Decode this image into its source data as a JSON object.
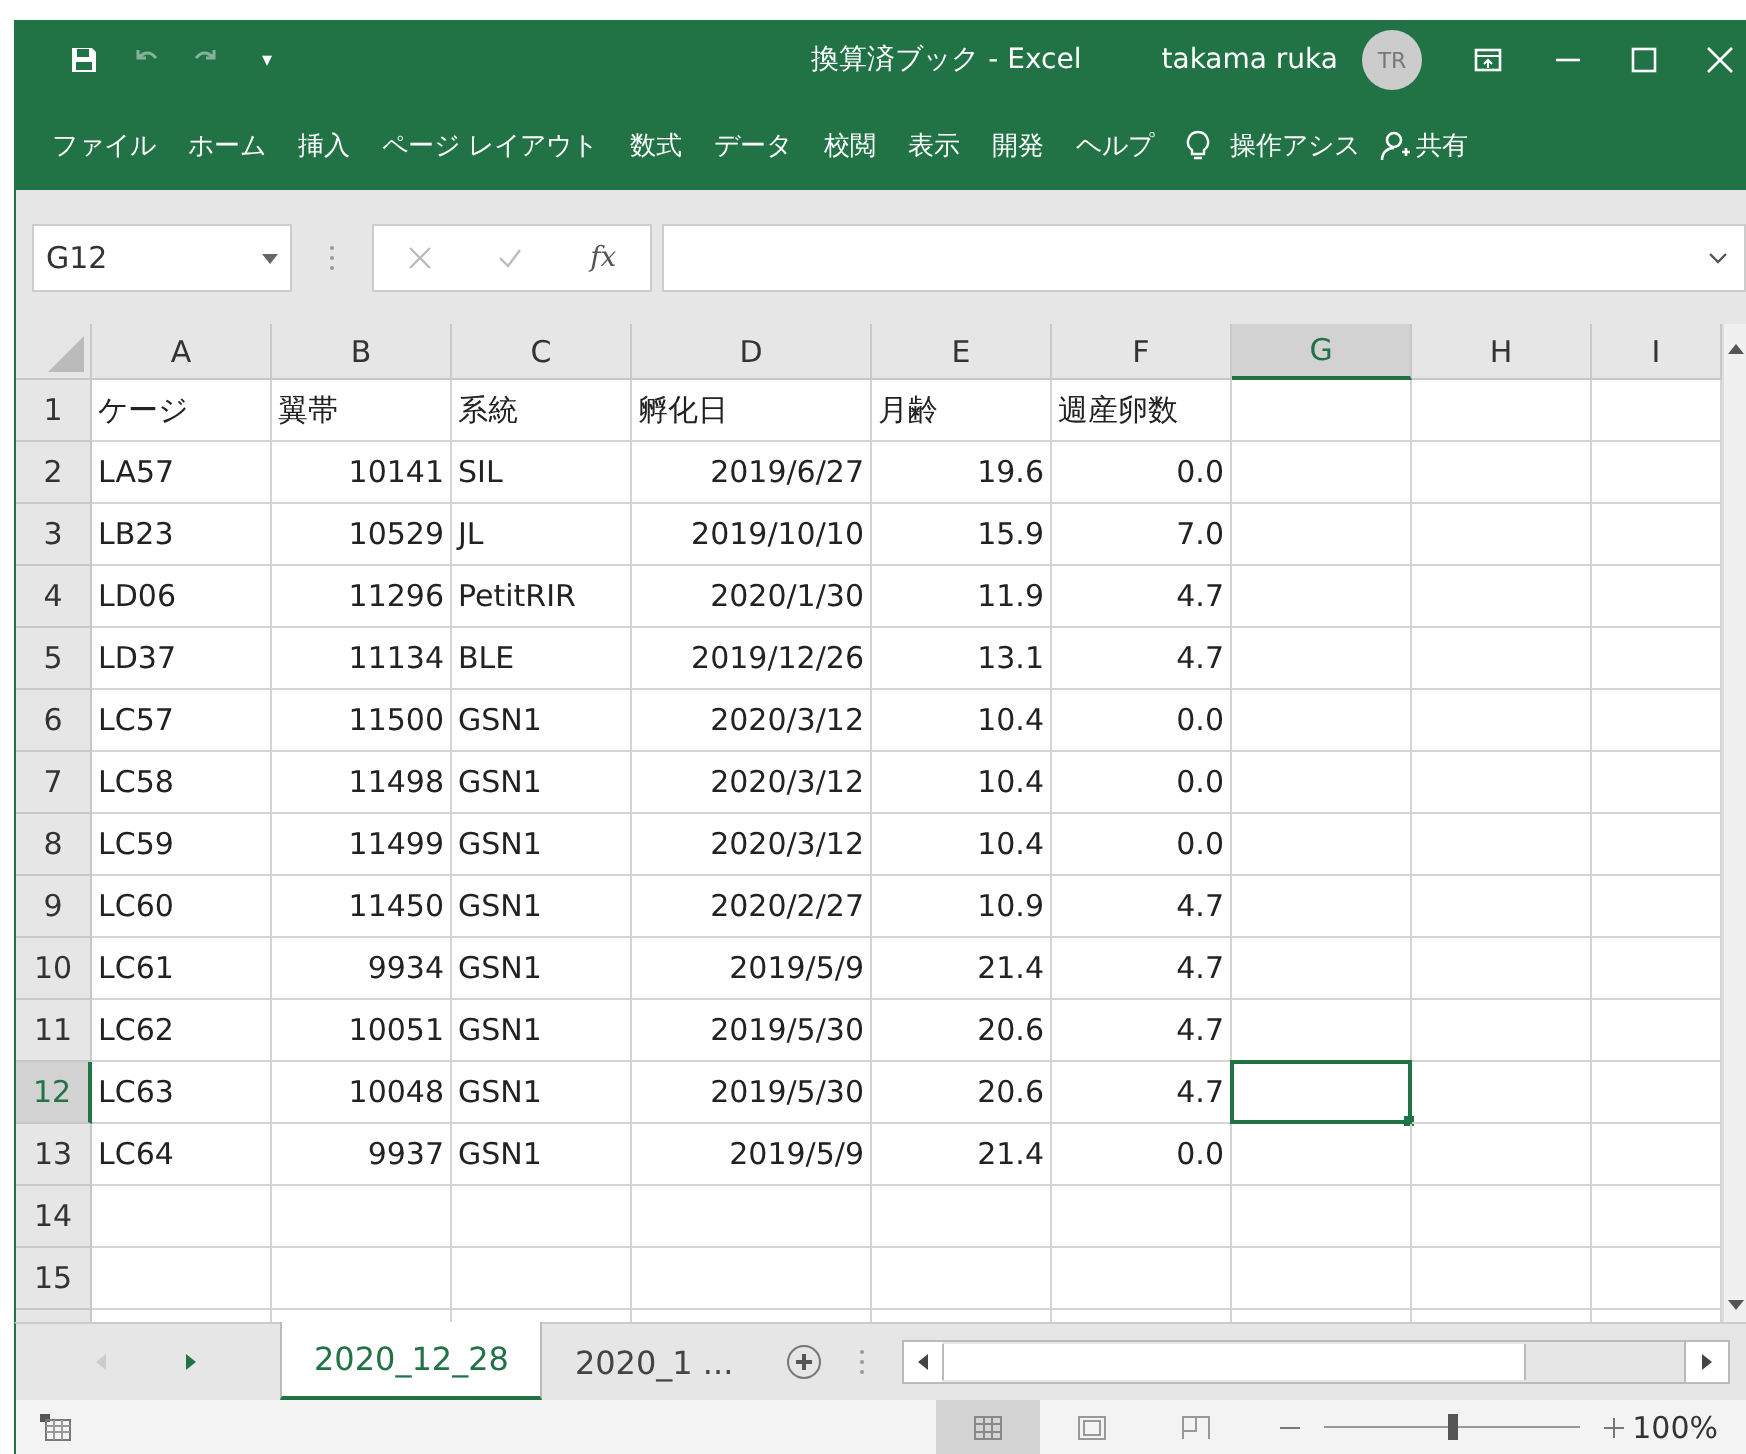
{
  "window": {
    "title": "換算済ブック  -  Excel",
    "user": "takama ruka",
    "avatar": "TR"
  },
  "qat": {
    "dropdown": "▾"
  },
  "ribbon_tabs": [
    {
      "label": "ファイル"
    },
    {
      "label": "ホーム"
    },
    {
      "label": "挿入"
    },
    {
      "label": "ページ レイアウト"
    },
    {
      "label": "数式"
    },
    {
      "label": "データ"
    },
    {
      "label": "校閲"
    },
    {
      "label": "表示"
    },
    {
      "label": "開発"
    },
    {
      "label": "ヘルプ"
    }
  ],
  "tell_me": "操作アシス",
  "share": "共有",
  "formula_bar": {
    "name_box": "G12",
    "fx": "fx"
  },
  "columns": [
    {
      "label": "A",
      "kind": "text",
      "selected": false
    },
    {
      "label": "B",
      "kind": "number",
      "selected": false
    },
    {
      "label": "C",
      "kind": "text",
      "selected": false
    },
    {
      "label": "D",
      "kind": "number",
      "selected": false
    },
    {
      "label": "E",
      "kind": "number",
      "selected": false
    },
    {
      "label": "F",
      "kind": "number",
      "selected": false
    },
    {
      "label": "G",
      "kind": "text",
      "selected": true
    },
    {
      "label": "H",
      "kind": "text",
      "selected": false
    },
    {
      "label": "I",
      "kind": "text",
      "selected": false
    }
  ],
  "rows": [
    {
      "header": "1",
      "selected": false,
      "kind": "header",
      "cells": [
        "ケージ",
        "翼帯",
        "系統",
        "孵化日",
        "月齢",
        "週産卵数"
      ]
    },
    {
      "header": "2",
      "selected": false,
      "kind": "data",
      "cells": [
        "LA57",
        "10141",
        "SIL",
        "2019/6/27",
        "19.6",
        "0.0"
      ]
    },
    {
      "header": "3",
      "selected": false,
      "kind": "data",
      "cells": [
        "LB23",
        "10529",
        "JL",
        "2019/10/10",
        "15.9",
        "7.0"
      ]
    },
    {
      "header": "4",
      "selected": false,
      "kind": "data",
      "cells": [
        "LD06",
        "11296",
        "PetitRIR",
        "2020/1/30",
        "11.9",
        "4.7"
      ]
    },
    {
      "header": "5",
      "selected": false,
      "kind": "data",
      "cells": [
        "LD37",
        "11134",
        "BLE",
        "2019/12/26",
        "13.1",
        "4.7"
      ]
    },
    {
      "header": "6",
      "selected": false,
      "kind": "data",
      "cells": [
        "LC57",
        "11500",
        "GSN1",
        "2020/3/12",
        "10.4",
        "0.0"
      ]
    },
    {
      "header": "7",
      "selected": false,
      "kind": "data",
      "cells": [
        "LC58",
        "11498",
        "GSN1",
        "2020/3/12",
        "10.4",
        "0.0"
      ]
    },
    {
      "header": "8",
      "selected": false,
      "kind": "data",
      "cells": [
        "LC59",
        "11499",
        "GSN1",
        "2020/3/12",
        "10.4",
        "0.0"
      ]
    },
    {
      "header": "9",
      "selected": false,
      "kind": "data",
      "cells": [
        "LC60",
        "11450",
        "GSN1",
        "2020/2/27",
        "10.9",
        "4.7"
      ]
    },
    {
      "header": "10",
      "selected": false,
      "kind": "data",
      "cells": [
        "LC61",
        "9934",
        "GSN1",
        "2019/5/9",
        "21.4",
        "4.7"
      ]
    },
    {
      "header": "11",
      "selected": false,
      "kind": "data",
      "cells": [
        "LC62",
        "10051",
        "GSN1",
        "2019/5/30",
        "20.6",
        "4.7"
      ]
    },
    {
      "header": "12",
      "selected": true,
      "kind": "data",
      "cells": [
        "LC63",
        "10048",
        "GSN1",
        "2019/5/30",
        "20.6",
        "4.7"
      ]
    },
    {
      "header": "13",
      "selected": false,
      "kind": "data",
      "cells": [
        "LC64",
        "9937",
        "GSN1",
        "2019/5/9",
        "21.4",
        "0.0"
      ]
    },
    {
      "header": "14",
      "selected": false,
      "kind": "data"
    },
    {
      "header": "15",
      "selected": false,
      "kind": "data"
    }
  ],
  "sheet_tabs": [
    {
      "label": "2020_12_28",
      "selected": true
    },
    {
      "label": "2020_1 ...",
      "selected": false
    }
  ],
  "status_bar": {
    "zoom": "100%",
    "zoom_slider": {
      "level": 0.5
    }
  }
}
